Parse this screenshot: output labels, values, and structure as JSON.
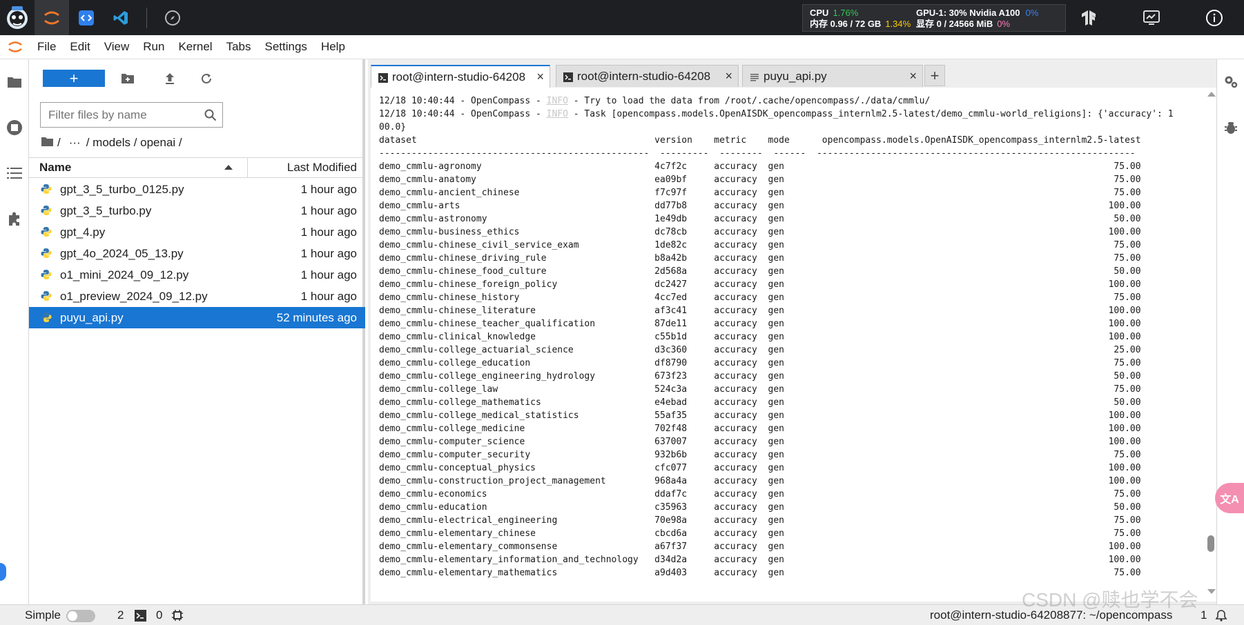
{
  "sysmon": {
    "cpu_label": "CPU",
    "cpu_value": "1.76%",
    "mem_label": "内存 0.96 / 72 GB",
    "mem_value": "1.34%",
    "gpu_label": "GPU-1: 30% Nvidia A100",
    "gpu_value": "0%",
    "vram_label": "显存 0 / 24566 MiB",
    "vram_value": "0%"
  },
  "menu": [
    "File",
    "Edit",
    "View",
    "Run",
    "Kernel",
    "Tabs",
    "Settings",
    "Help"
  ],
  "filebrowser": {
    "new_label": "+",
    "filter_placeholder": "Filter files by name",
    "breadcrumb": [
      "/",
      "···",
      "/ models / openai /"
    ],
    "col_name": "Name",
    "col_modified": "Last Modified",
    "files": [
      {
        "name": "gpt_3_5_turbo_0125.py",
        "modified": "1 hour ago"
      },
      {
        "name": "gpt_3_5_turbo.py",
        "modified": "1 hour ago"
      },
      {
        "name": "gpt_4.py",
        "modified": "1 hour ago"
      },
      {
        "name": "gpt_4o_2024_05_13.py",
        "modified": "1 hour ago"
      },
      {
        "name": "o1_mini_2024_09_12.py",
        "modified": "1 hour ago"
      },
      {
        "name": "o1_preview_2024_09_12.py",
        "modified": "1 hour ago"
      },
      {
        "name": "puyu_api.py",
        "modified": "52 minutes ago",
        "selected": true
      }
    ]
  },
  "tabs": [
    {
      "label": "root@intern-studio-64208",
      "type": "terminal",
      "active": true
    },
    {
      "label": "root@intern-studio-64208",
      "type": "terminal",
      "active": false
    },
    {
      "label": "puyu_api.py",
      "type": "file",
      "active": false
    }
  ],
  "tab_add": "+",
  "terminal": {
    "log_lines": [
      {
        "prefix": "12/18 10:40:44 - OpenCompass - ",
        "level": "INFO",
        "msg": " - Try to load the data from /root/.cache/opencompass/./data/cmmlu/"
      },
      {
        "prefix": "12/18 10:40:44 - OpenCompass - ",
        "level": "INFO",
        "msg": " - Task [opencompass.models.OpenAISDK_opencompass_internlm2.5-latest/demo_cmmlu-world_religions]: {'accuracy': 1"
      }
    ],
    "wrap_line": "00.0}",
    "header": [
      "dataset",
      "version",
      "metric",
      "mode",
      "opencompass.models.OpenAISDK_opencompass_internlm2.5-latest"
    ],
    "rows": [
      [
        "demo_cmmlu-agronomy",
        "4c7f2c",
        "accuracy",
        "gen",
        "75.00"
      ],
      [
        "demo_cmmlu-anatomy",
        "ea09bf",
        "accuracy",
        "gen",
        "75.00"
      ],
      [
        "demo_cmmlu-ancient_chinese",
        "f7c97f",
        "accuracy",
        "gen",
        "75.00"
      ],
      [
        "demo_cmmlu-arts",
        "dd77b8",
        "accuracy",
        "gen",
        "100.00"
      ],
      [
        "demo_cmmlu-astronomy",
        "1e49db",
        "accuracy",
        "gen",
        "50.00"
      ],
      [
        "demo_cmmlu-business_ethics",
        "dc78cb",
        "accuracy",
        "gen",
        "100.00"
      ],
      [
        "demo_cmmlu-chinese_civil_service_exam",
        "1de82c",
        "accuracy",
        "gen",
        "75.00"
      ],
      [
        "demo_cmmlu-chinese_driving_rule",
        "b8a42b",
        "accuracy",
        "gen",
        "75.00"
      ],
      [
        "demo_cmmlu-chinese_food_culture",
        "2d568a",
        "accuracy",
        "gen",
        "50.00"
      ],
      [
        "demo_cmmlu-chinese_foreign_policy",
        "dc2427",
        "accuracy",
        "gen",
        "100.00"
      ],
      [
        "demo_cmmlu-chinese_history",
        "4cc7ed",
        "accuracy",
        "gen",
        "75.00"
      ],
      [
        "demo_cmmlu-chinese_literature",
        "af3c41",
        "accuracy",
        "gen",
        "100.00"
      ],
      [
        "demo_cmmlu-chinese_teacher_qualification",
        "87de11",
        "accuracy",
        "gen",
        "100.00"
      ],
      [
        "demo_cmmlu-clinical_knowledge",
        "c55b1d",
        "accuracy",
        "gen",
        "100.00"
      ],
      [
        "demo_cmmlu-college_actuarial_science",
        "d3c360",
        "accuracy",
        "gen",
        "25.00"
      ],
      [
        "demo_cmmlu-college_education",
        "df8790",
        "accuracy",
        "gen",
        "75.00"
      ],
      [
        "demo_cmmlu-college_engineering_hydrology",
        "673f23",
        "accuracy",
        "gen",
        "50.00"
      ],
      [
        "demo_cmmlu-college_law",
        "524c3a",
        "accuracy",
        "gen",
        "75.00"
      ],
      [
        "demo_cmmlu-college_mathematics",
        "e4ebad",
        "accuracy",
        "gen",
        "50.00"
      ],
      [
        "demo_cmmlu-college_medical_statistics",
        "55af35",
        "accuracy",
        "gen",
        "100.00"
      ],
      [
        "demo_cmmlu-college_medicine",
        "702f48",
        "accuracy",
        "gen",
        "100.00"
      ],
      [
        "demo_cmmlu-computer_science",
        "637007",
        "accuracy",
        "gen",
        "100.00"
      ],
      [
        "demo_cmmlu-computer_security",
        "932b6b",
        "accuracy",
        "gen",
        "75.00"
      ],
      [
        "demo_cmmlu-conceptual_physics",
        "cfc077",
        "accuracy",
        "gen",
        "100.00"
      ],
      [
        "demo_cmmlu-construction_project_management",
        "968a4a",
        "accuracy",
        "gen",
        "100.00"
      ],
      [
        "demo_cmmlu-economics",
        "ddaf7c",
        "accuracy",
        "gen",
        "75.00"
      ],
      [
        "demo_cmmlu-education",
        "c35963",
        "accuracy",
        "gen",
        "50.00"
      ],
      [
        "demo_cmmlu-electrical_engineering",
        "70e98a",
        "accuracy",
        "gen",
        "75.00"
      ],
      [
        "demo_cmmlu-elementary_chinese",
        "cbcd6a",
        "accuracy",
        "gen",
        "75.00"
      ],
      [
        "demo_cmmlu-elementary_commonsense",
        "a67f37",
        "accuracy",
        "gen",
        "100.00"
      ],
      [
        "demo_cmmlu-elementary_information_and_technology",
        "d34d2a",
        "accuracy",
        "gen",
        "100.00"
      ],
      [
        "demo_cmmlu-elementary_mathematics",
        "a9d403",
        "accuracy",
        "gen",
        "75.00"
      ]
    ]
  },
  "status": {
    "mode_label": "Simple",
    "terminals_count": "2",
    "kernels_count": "0",
    "right_text": "root@intern-studio-64208877: ~/opencompass",
    "right_count": "1"
  },
  "translate_label": "文A",
  "watermark": "CSDN @赎也学不会"
}
